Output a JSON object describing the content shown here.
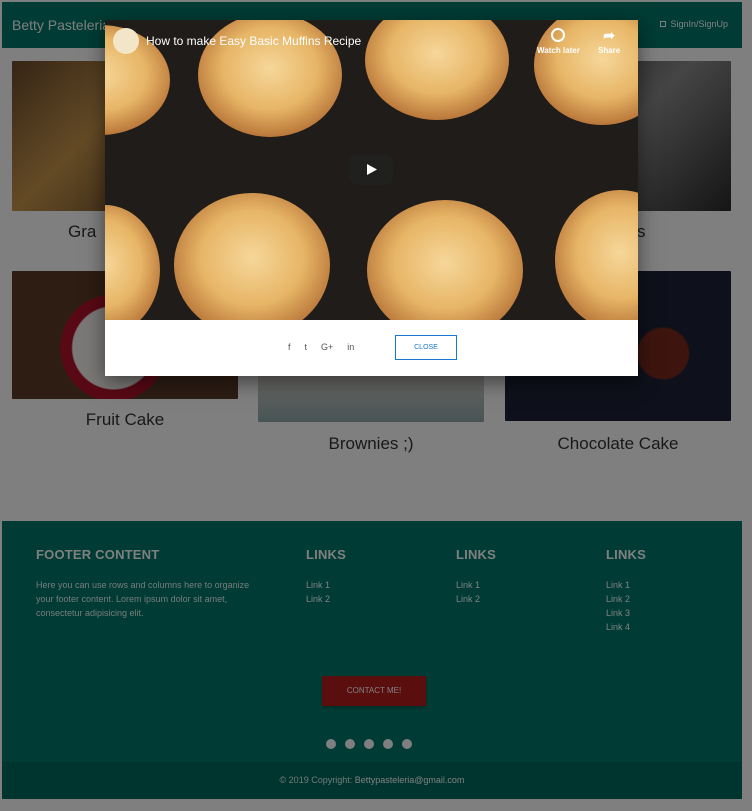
{
  "navbar": {
    "brand": "Betty Pasteleria",
    "signin_label": "SignIn/SignUp"
  },
  "cards": [
    {
      "title": "Gra",
      "image": "pastries-photo"
    },
    {
      "title": "Fruit Cake",
      "image": "fruit-cake-photo"
    },
    {
      "title": "Brownies ;)",
      "image": "brownies-photo"
    },
    {
      "title": "Chocolate Cake",
      "image": "chocolate-cake-photo"
    },
    {
      "title": "s",
      "image": "oven-photo"
    }
  ],
  "modal": {
    "video_title": "How to make Easy Basic Muffins Recipe",
    "watch_later_label": "Watch later",
    "share_label": "Share",
    "share_icons": [
      "f",
      "t",
      "G+",
      "in"
    ],
    "close_label": "CLOSE"
  },
  "footer": {
    "content_heading": "FOOTER CONTENT",
    "content_text": "Here you can use rows and columns here to organize your footer content. Lorem ipsum dolor sit amet, consectetur adipisicing elit.",
    "links_columns": [
      {
        "heading": "LINKS",
        "links": [
          "Link 1",
          "Link 2"
        ]
      },
      {
        "heading": "LINKS",
        "links": [
          "Link 1",
          "Link 2"
        ]
      },
      {
        "heading": "LINKS",
        "links": [
          "Link 1",
          "Link 2",
          "Link 3",
          "Link 4"
        ]
      }
    ],
    "contact_label": "CONTACT ME!",
    "social_icons": [
      "facebook-icon",
      "twitter-icon",
      "google-plus-icon",
      "linkedin-icon",
      "dribbble-icon"
    ],
    "copyright_prefix": "© 2019 Copyright:",
    "copyright_email": "Bettypasteleria@gmail.com"
  },
  "colors": {
    "teal": "#00796b",
    "teal_dark": "#00695c",
    "contact_red": "#b71c1c",
    "close_blue": "#1976d2"
  }
}
